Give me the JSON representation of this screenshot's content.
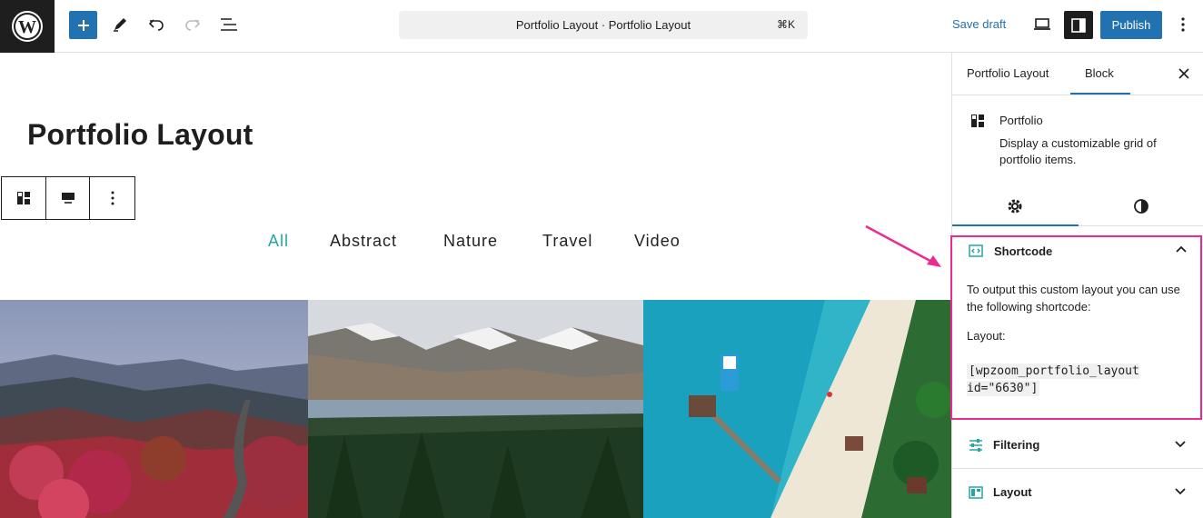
{
  "topbar": {
    "command_title": "Portfolio Layout · Portfolio Layout",
    "command_shortcut": "⌘K",
    "save_draft": "Save draft",
    "publish": "Publish"
  },
  "canvas": {
    "page_title": "Portfolio Layout",
    "filters": [
      "All",
      "Abstract",
      "Nature",
      "Travel",
      "Video"
    ],
    "active_filter_color": "#27a6a0"
  },
  "sidebar": {
    "tabs": [
      "Portfolio Layout",
      "Block"
    ],
    "block": {
      "name": "Portfolio",
      "description": "Display a customizable grid of portfolio items."
    },
    "shortcode": {
      "title": "Shortcode",
      "text": "To output this custom layout you can use the following shortcode:",
      "layout_label": "Layout:",
      "code": "[wpzoom_portfolio_layout id=\"6630\"]"
    },
    "filtering": {
      "title": "Filtering"
    },
    "layout": {
      "title": "Layout"
    }
  },
  "colors": {
    "accent": "#2271b1",
    "highlight": "#e92c8f",
    "dark": "#1e1e1e"
  }
}
